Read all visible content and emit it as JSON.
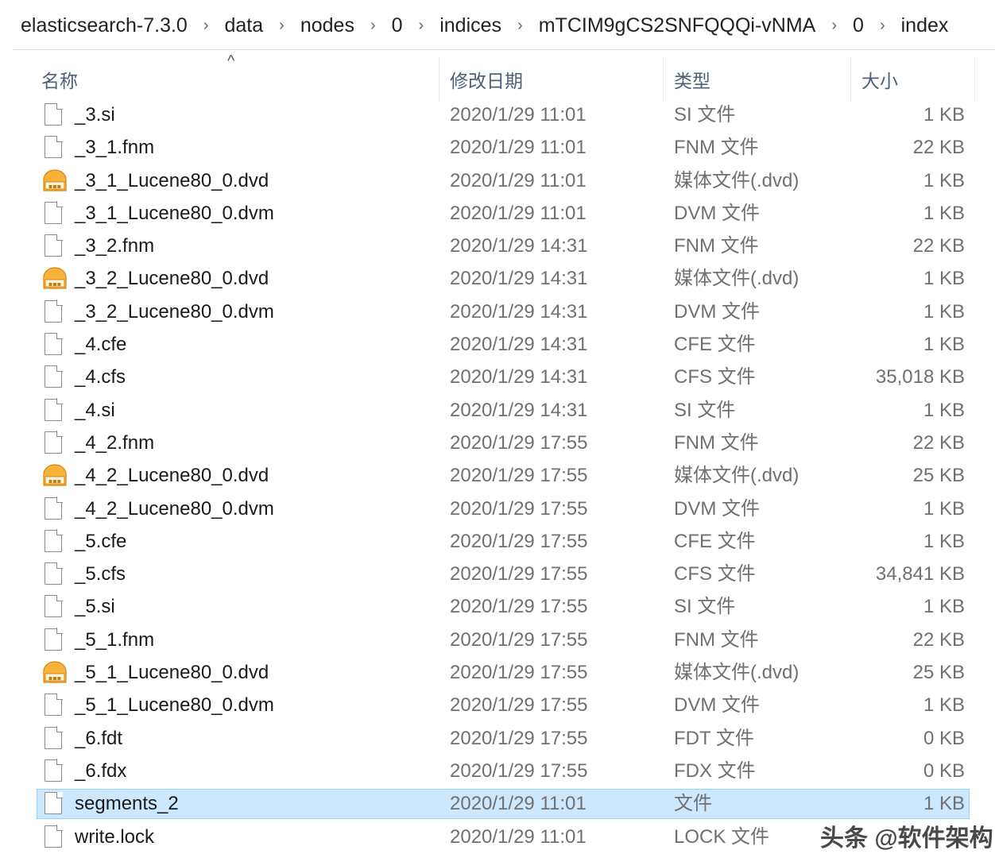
{
  "breadcrumb": [
    "elasticsearch-7.3.0",
    "data",
    "nodes",
    "0",
    "indices",
    "mTCIM9gCS2SNFQQQi-vNMA",
    "0",
    "index"
  ],
  "breadcrumb_separator": "›",
  "columns": {
    "name": "名称",
    "date": "修改日期",
    "type": "类型",
    "size": "大小"
  },
  "sort_indicator": "^",
  "files": [
    {
      "name": "_3.si",
      "date": "2020/1/29 11:01",
      "type": "SI 文件",
      "size": "1 KB",
      "icon": "document-icon"
    },
    {
      "name": "_3_1.fnm",
      "date": "2020/1/29 11:01",
      "type": "FNM 文件",
      "size": "22 KB",
      "icon": "document-icon"
    },
    {
      "name": "_3_1_Lucene80_0.dvd",
      "date": "2020/1/29 11:01",
      "type": "媒体文件(.dvd)",
      "size": "1 KB",
      "icon": "media-file-icon"
    },
    {
      "name": "_3_1_Lucene80_0.dvm",
      "date": "2020/1/29 11:01",
      "type": "DVM 文件",
      "size": "1 KB",
      "icon": "document-icon"
    },
    {
      "name": "_3_2.fnm",
      "date": "2020/1/29 14:31",
      "type": "FNM 文件",
      "size": "22 KB",
      "icon": "document-icon"
    },
    {
      "name": "_3_2_Lucene80_0.dvd",
      "date": "2020/1/29 14:31",
      "type": "媒体文件(.dvd)",
      "size": "1 KB",
      "icon": "media-file-icon"
    },
    {
      "name": "_3_2_Lucene80_0.dvm",
      "date": "2020/1/29 14:31",
      "type": "DVM 文件",
      "size": "1 KB",
      "icon": "document-icon"
    },
    {
      "name": "_4.cfe",
      "date": "2020/1/29 14:31",
      "type": "CFE 文件",
      "size": "1 KB",
      "icon": "document-icon"
    },
    {
      "name": "_4.cfs",
      "date": "2020/1/29 14:31",
      "type": "CFS 文件",
      "size": "35,018 KB",
      "icon": "document-icon"
    },
    {
      "name": "_4.si",
      "date": "2020/1/29 14:31",
      "type": "SI 文件",
      "size": "1 KB",
      "icon": "document-icon"
    },
    {
      "name": "_4_2.fnm",
      "date": "2020/1/29 17:55",
      "type": "FNM 文件",
      "size": "22 KB",
      "icon": "document-icon"
    },
    {
      "name": "_4_2_Lucene80_0.dvd",
      "date": "2020/1/29 17:55",
      "type": "媒体文件(.dvd)",
      "size": "25 KB",
      "icon": "media-file-icon"
    },
    {
      "name": "_4_2_Lucene80_0.dvm",
      "date": "2020/1/29 17:55",
      "type": "DVM 文件",
      "size": "1 KB",
      "icon": "document-icon"
    },
    {
      "name": "_5.cfe",
      "date": "2020/1/29 17:55",
      "type": "CFE 文件",
      "size": "1 KB",
      "icon": "document-icon"
    },
    {
      "name": "_5.cfs",
      "date": "2020/1/29 17:55",
      "type": "CFS 文件",
      "size": "34,841 KB",
      "icon": "document-icon"
    },
    {
      "name": "_5.si",
      "date": "2020/1/29 17:55",
      "type": "SI 文件",
      "size": "1 KB",
      "icon": "document-icon"
    },
    {
      "name": "_5_1.fnm",
      "date": "2020/1/29 17:55",
      "type": "FNM 文件",
      "size": "22 KB",
      "icon": "document-icon"
    },
    {
      "name": "_5_1_Lucene80_0.dvd",
      "date": "2020/1/29 17:55",
      "type": "媒体文件(.dvd)",
      "size": "25 KB",
      "icon": "media-file-icon"
    },
    {
      "name": "_5_1_Lucene80_0.dvm",
      "date": "2020/1/29 17:55",
      "type": "DVM 文件",
      "size": "1 KB",
      "icon": "document-icon"
    },
    {
      "name": "_6.fdt",
      "date": "2020/1/29 17:55",
      "type": "FDT 文件",
      "size": "0 KB",
      "icon": "document-icon"
    },
    {
      "name": "_6.fdx",
      "date": "2020/1/29 17:55",
      "type": "FDX 文件",
      "size": "0 KB",
      "icon": "document-icon"
    },
    {
      "name": "segments_2",
      "date": "2020/1/29 11:01",
      "type": "文件",
      "size": "1 KB",
      "icon": "document-icon",
      "selected": true
    },
    {
      "name": "write.lock",
      "date": "2020/1/29 11:01",
      "type": "LOCK 文件",
      "size": "",
      "icon": "document-icon"
    }
  ],
  "watermark": "头条 @软件架构",
  "colors": {
    "selection_bg": "#cce8ff",
    "selection_border": "#99d1ff",
    "header_text": "#4c607a",
    "media_icon": "#f0a020"
  }
}
